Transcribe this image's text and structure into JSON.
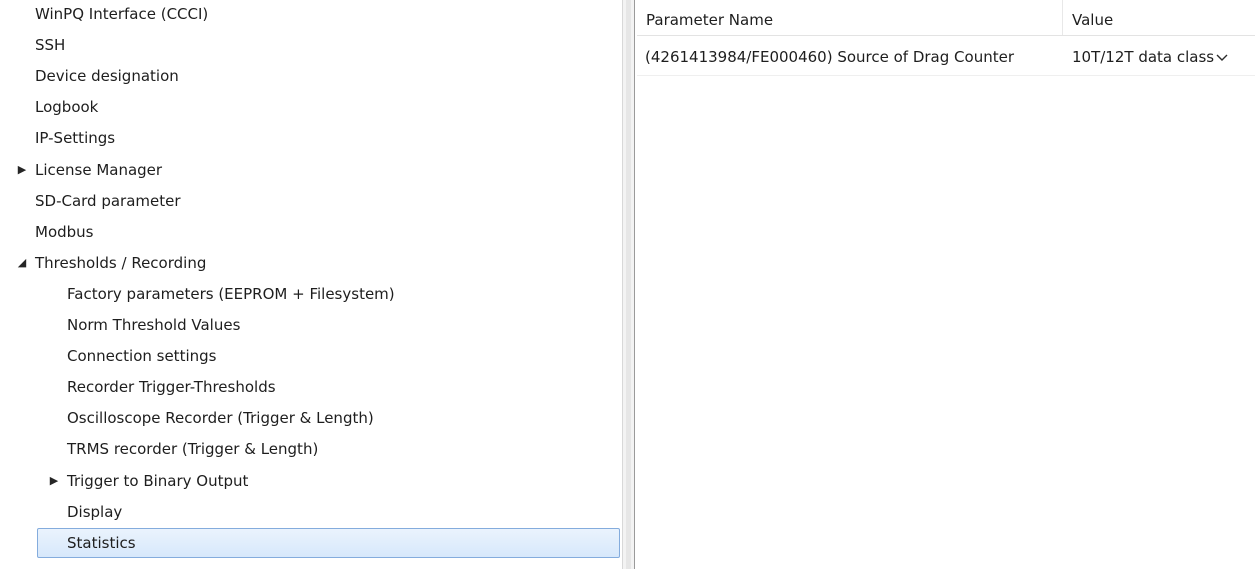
{
  "tree": {
    "items": [
      {
        "label": "WinPQ Interface (CCCI)",
        "level": 0,
        "toggle": ""
      },
      {
        "label": "SSH",
        "level": 0,
        "toggle": ""
      },
      {
        "label": "Device designation",
        "level": 0,
        "toggle": ""
      },
      {
        "label": "Logbook",
        "level": 0,
        "toggle": ""
      },
      {
        "label": "IP-Settings",
        "level": 0,
        "toggle": ""
      },
      {
        "label": "License Manager",
        "level": 0,
        "toggle": "collapsed"
      },
      {
        "label": "SD-Card parameter",
        "level": 0,
        "toggle": ""
      },
      {
        "label": "Modbus",
        "level": 0,
        "toggle": ""
      },
      {
        "label": "Thresholds / Recording",
        "level": 0,
        "toggle": "expanded"
      },
      {
        "label": "Factory parameters  (EEPROM + Filesystem)",
        "level": 1,
        "toggle": ""
      },
      {
        "label": "Norm Threshold Values",
        "level": 1,
        "toggle": ""
      },
      {
        "label": "Connection settings",
        "level": 1,
        "toggle": ""
      },
      {
        "label": "Recorder Trigger-Thresholds",
        "level": 1,
        "toggle": ""
      },
      {
        "label": "Oscilloscope Recorder (Trigger & Length)",
        "level": 1,
        "toggle": ""
      },
      {
        "label": "TRMS recorder (Trigger & Length)",
        "level": 1,
        "toggle": ""
      },
      {
        "label": "Trigger to Binary Output",
        "level": 1,
        "toggle": "collapsed"
      },
      {
        "label": "Display",
        "level": 1,
        "toggle": ""
      },
      {
        "label": "Statistics",
        "level": 1,
        "toggle": "",
        "selected": true
      }
    ],
    "glyphs": {
      "collapsed": "▶",
      "expanded": "◢"
    }
  },
  "grid": {
    "columns": {
      "name": "Parameter Name",
      "value": "Value"
    },
    "rows": [
      {
        "name": "(4261413984/FE000460) Source of Drag Counter",
        "value": "10T/12T data class",
        "icon": "chevron-down-icon"
      }
    ]
  },
  "colors": {
    "selection_border": "#84acdd",
    "selection_fill": "#dbe9fb"
  }
}
